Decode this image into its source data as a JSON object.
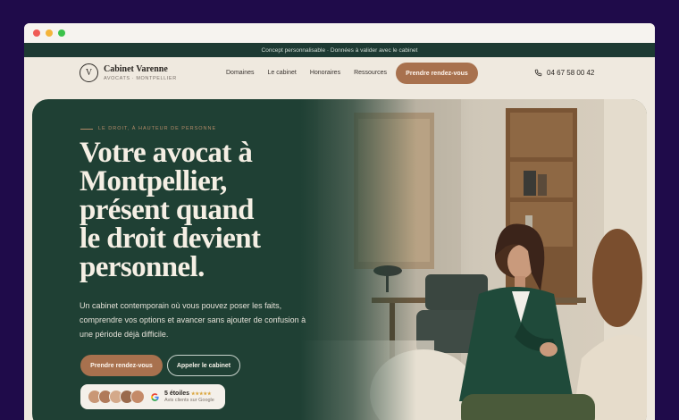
{
  "topbar": {
    "text": "Concept personnalisable · Données à valider avec le cabinet"
  },
  "brand": {
    "initial": "V",
    "name": "Cabinet Varenne",
    "subtitle": "AVOCATS · MONTPELLIER"
  },
  "nav": {
    "links": [
      "Domaines",
      "Le cabinet",
      "Honoraires",
      "Ressources"
    ],
    "cta_label": "Prendre rendez-vous",
    "phone": "04 67 58 00 42"
  },
  "hero": {
    "eyebrow": "LE DROIT, À HAUTEUR DE PERSONNE",
    "headline_lines": [
      "Votre avocat à",
      "Montpellier,",
      "présent quand",
      "le droit devient",
      "personnel."
    ],
    "lead": "Un cabinet contemporain où vous pouvez poser les faits, comprendre vos options et avancer sans ajouter de confusion à une période déjà difficile.",
    "primary_button": "Prendre rendez-vous",
    "secondary_button": "Appeler le cabinet",
    "reviews": {
      "title": "5 étoiles",
      "stars": "★★★★★",
      "subtitle": "Avis clients sur Google"
    }
  },
  "colors": {
    "hero_green": "#1f4034",
    "accent_copper": "#a8714e",
    "cream": "#efe9df",
    "topbar": "#1d3a33"
  },
  "icons": [
    "phone-icon",
    "google-icon",
    "logo-monogram"
  ]
}
